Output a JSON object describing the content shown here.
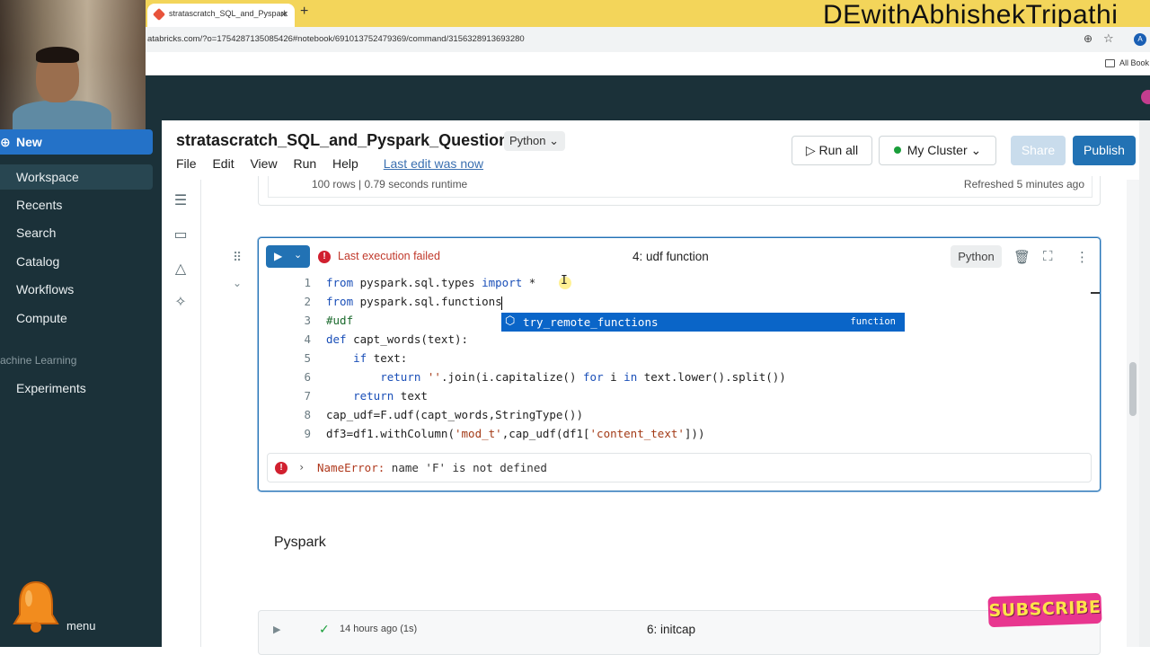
{
  "browser": {
    "tab_title": "stratascratch_SQL_and_Pyspark",
    "new_tab_symbol": "+",
    "close_symbol": "×",
    "url": "atabricks.com/?o=1754287135085426#notebook/691013752479369/command/3156328913693280",
    "all_bookmarks": "All Book",
    "profile_initial": "A"
  },
  "watermark": "DEwithAbhishekTripathi",
  "sidebar": {
    "new_label": "New",
    "items": [
      {
        "label": "Workspace"
      },
      {
        "label": "Recents"
      },
      {
        "label": "Search"
      },
      {
        "label": "Catalog"
      },
      {
        "label": "Workflows"
      },
      {
        "label": "Compute"
      }
    ],
    "ml_heading": "achine Learning",
    "ml_items": [
      {
        "label": "Experiments"
      }
    ],
    "menu_label": "menu"
  },
  "notebook": {
    "title": "stratascratch_SQL_and_Pyspark_Question",
    "language": "Python",
    "menu": [
      "File",
      "Edit",
      "View",
      "Run",
      "Help"
    ],
    "last_edit": "Last edit was now",
    "run_all": "Run all",
    "cluster": "My Cluster",
    "share": "Share",
    "publish": "Publish"
  },
  "prev_cell": {
    "rows": "100 rows",
    "runtime": "0.79 seconds runtime",
    "refreshed": "Refreshed 5 minutes ago"
  },
  "cell": {
    "status": "Last execution failed",
    "title": "4:  udf function",
    "language": "Python",
    "code": [
      {
        "n": "1",
        "parts": [
          [
            "kw",
            "from"
          ],
          [
            "t",
            " pyspark.sql.types "
          ],
          [
            "kw",
            "import"
          ],
          [
            "t",
            " *"
          ]
        ]
      },
      {
        "n": "2",
        "parts": [
          [
            "kw",
            "from"
          ],
          [
            "t",
            " pyspark.sql.functions"
          ]
        ]
      },
      {
        "n": "3",
        "parts": [
          [
            "cm",
            "#udf"
          ]
        ]
      },
      {
        "n": "4",
        "parts": [
          [
            "kw",
            "def"
          ],
          [
            "t",
            " capt_words(text):"
          ]
        ]
      },
      {
        "n": "5",
        "parts": [
          [
            "t",
            "    "
          ],
          [
            "kw",
            "if"
          ],
          [
            "t",
            " text:"
          ]
        ]
      },
      {
        "n": "6",
        "parts": [
          [
            "t",
            "        "
          ],
          [
            "kw",
            "return"
          ],
          [
            "t",
            " "
          ],
          [
            "str",
            "''"
          ],
          [
            "t",
            ".join(i.capitalize() "
          ],
          [
            "kw",
            "for"
          ],
          [
            "t",
            " i "
          ],
          [
            "kw",
            "in"
          ],
          [
            "t",
            " text.lower().split())"
          ]
        ]
      },
      {
        "n": "7",
        "parts": [
          [
            "t",
            "    "
          ],
          [
            "kw",
            "return"
          ],
          [
            "t",
            " text"
          ]
        ]
      },
      {
        "n": "8",
        "parts": [
          [
            "t",
            "cap_udf=F.udf(capt_words,StringType())"
          ]
        ]
      },
      {
        "n": "9",
        "parts": [
          [
            "t",
            "df3=df1.withColumn("
          ],
          [
            "str",
            "'mod_t'"
          ],
          [
            "t",
            ",cap_udf(df1["
          ],
          [
            "str",
            "'content_text'"
          ],
          [
            "t",
            "]))"
          ]
        ]
      }
    ],
    "autocomplete": {
      "label": "try_remote_functions",
      "kind": "function"
    },
    "error_name": "NameError:",
    "error_message": " name 'F' is not defined"
  },
  "markdown_text": "Pyspark",
  "cell2": {
    "time": "14 hours ago (1s)",
    "title": "6:  initcap"
  },
  "subscribe": "SUBSCRIBE",
  "colors": {
    "tab_bar": "#f3d55a",
    "sidebar": "#1b3139",
    "accent": "#2272b4",
    "error": "#d1202f",
    "keyword": "#1a4fb8"
  }
}
